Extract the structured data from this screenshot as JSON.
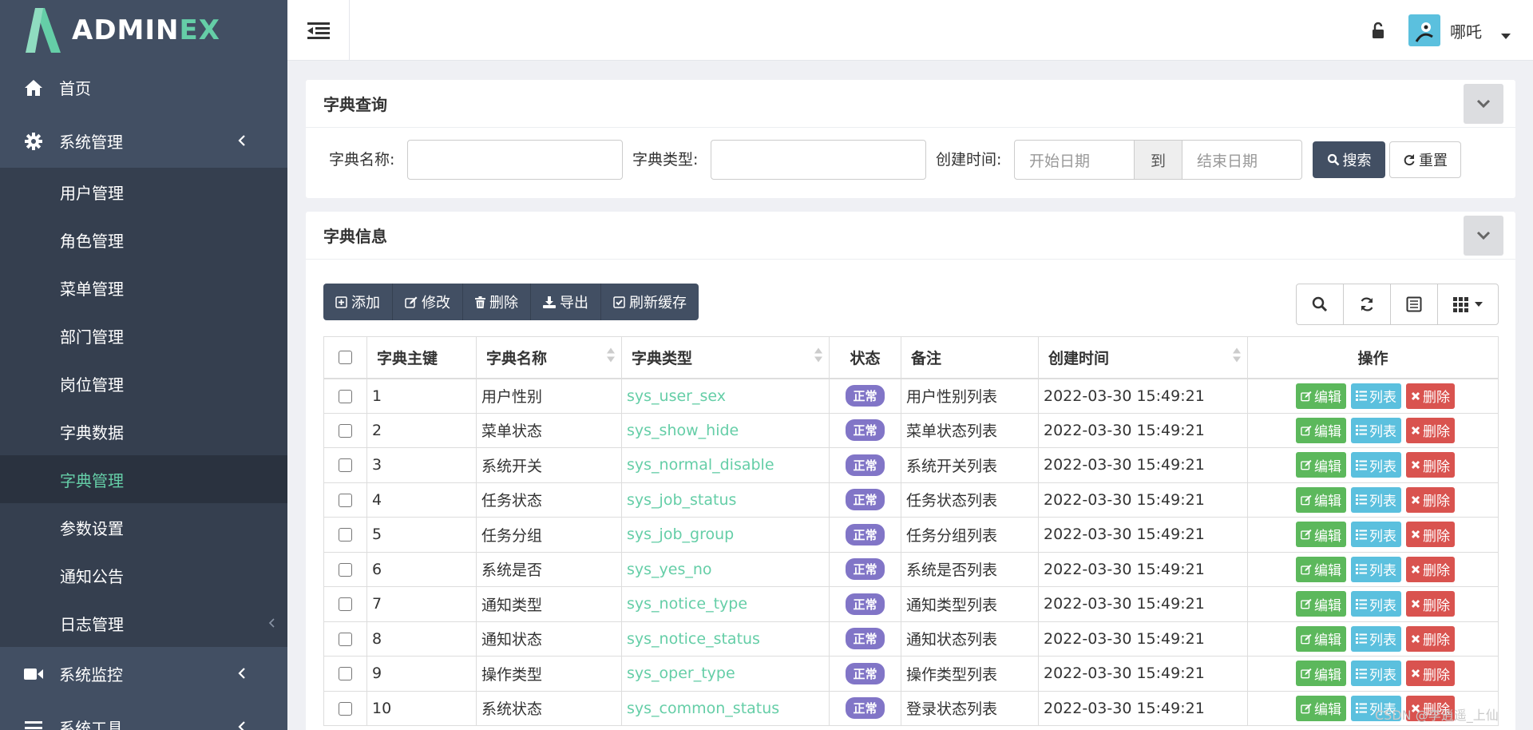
{
  "brand": {
    "name_main": "ADMIN",
    "name_accent": "EX"
  },
  "sidebar": {
    "home": {
      "label": "首页",
      "icon": "home-icon"
    },
    "system_mgmt": {
      "label": "系统管理",
      "icon": "gear-icon"
    },
    "sub_items": [
      {
        "label": "用户管理"
      },
      {
        "label": "角色管理"
      },
      {
        "label": "菜单管理"
      },
      {
        "label": "部门管理"
      },
      {
        "label": "岗位管理"
      },
      {
        "label": "字典数据"
      },
      {
        "label": "字典管理"
      },
      {
        "label": "参数设置"
      },
      {
        "label": "通知公告"
      },
      {
        "label": "日志管理"
      }
    ],
    "active_index": 6,
    "monitor": {
      "label": "系统监控",
      "icon": "video-icon"
    },
    "tools": {
      "label": "系统工具",
      "icon": "bars-icon"
    }
  },
  "header": {
    "username": "哪吒"
  },
  "search_panel": {
    "title": "字典查询",
    "dict_name_label": "字典名称:",
    "dict_type_label": "字典类型:",
    "create_time_label": "创建时间:",
    "start_placeholder": "开始日期",
    "to_label": "到",
    "end_placeholder": "结束日期",
    "search_btn": "搜索",
    "reset_btn": "重置"
  },
  "info_panel": {
    "title": "字典信息",
    "toolbar": {
      "add": "添加",
      "edit": "修改",
      "delete": "删除",
      "export": "导出",
      "refresh_cache": "刷新缓存"
    }
  },
  "table": {
    "headers": {
      "id": "字典主键",
      "name": "字典名称",
      "type": "字典类型",
      "status": "状态",
      "remark": "备注",
      "created": "创建时间",
      "actions": "操作"
    },
    "action_labels": {
      "edit": "编辑",
      "list": "列表",
      "delete": "删除"
    },
    "rows": [
      {
        "id": "1",
        "name": "用户性别",
        "type": "sys_user_sex",
        "status": "正常",
        "remark": "用户性别列表",
        "created": "2022-03-30 15:49:21"
      },
      {
        "id": "2",
        "name": "菜单状态",
        "type": "sys_show_hide",
        "status": "正常",
        "remark": "菜单状态列表",
        "created": "2022-03-30 15:49:21"
      },
      {
        "id": "3",
        "name": "系统开关",
        "type": "sys_normal_disable",
        "status": "正常",
        "remark": "系统开关列表",
        "created": "2022-03-30 15:49:21"
      },
      {
        "id": "4",
        "name": "任务状态",
        "type": "sys_job_status",
        "status": "正常",
        "remark": "任务状态列表",
        "created": "2022-03-30 15:49:21"
      },
      {
        "id": "5",
        "name": "任务分组",
        "type": "sys_job_group",
        "status": "正常",
        "remark": "任务分组列表",
        "created": "2022-03-30 15:49:21"
      },
      {
        "id": "6",
        "name": "系统是否",
        "type": "sys_yes_no",
        "status": "正常",
        "remark": "系统是否列表",
        "created": "2022-03-30 15:49:21"
      },
      {
        "id": "7",
        "name": "通知类型",
        "type": "sys_notice_type",
        "status": "正常",
        "remark": "通知类型列表",
        "created": "2022-03-30 15:49:21"
      },
      {
        "id": "8",
        "name": "通知状态",
        "type": "sys_notice_status",
        "status": "正常",
        "remark": "通知状态列表",
        "created": "2022-03-30 15:49:21"
      },
      {
        "id": "9",
        "name": "操作类型",
        "type": "sys_oper_type",
        "status": "正常",
        "remark": "操作类型列表",
        "created": "2022-03-30 15:49:21"
      },
      {
        "id": "10",
        "name": "系统状态",
        "type": "sys_common_status",
        "status": "正常",
        "remark": "登录状态列表",
        "created": "2022-03-30 15:49:21"
      }
    ]
  },
  "watermark": "CSDN @李逍遥_上仙",
  "colors": {
    "sidebar": "#424f63",
    "submenu": "#353f4f",
    "accent": "#65cea7",
    "badge": "#8175c7",
    "edit": "#5cb85c",
    "list": "#5bc0de",
    "delete": "#d9534f"
  }
}
